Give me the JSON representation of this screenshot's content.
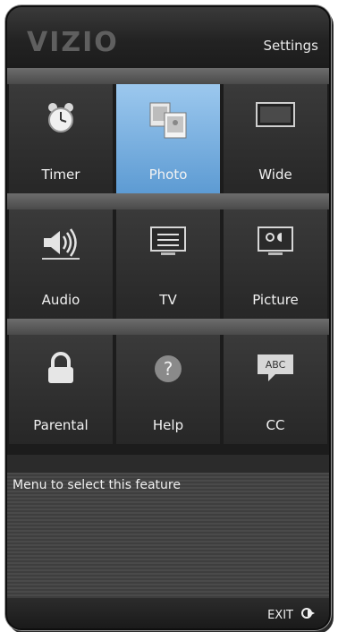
{
  "header": {
    "brand": "VIZIO",
    "title": "Settings"
  },
  "tiles": [
    {
      "label": "Timer",
      "icon": "alarm-clock-icon",
      "selected": false
    },
    {
      "label": "Photo",
      "icon": "photo-icon",
      "selected": true
    },
    {
      "label": "Wide",
      "icon": "widescreen-icon",
      "selected": false
    },
    {
      "label": "Audio",
      "icon": "speaker-icon",
      "selected": false
    },
    {
      "label": "TV",
      "icon": "tv-settings-icon",
      "selected": false
    },
    {
      "label": "Picture",
      "icon": "picture-settings-icon",
      "selected": false
    },
    {
      "label": "Parental",
      "icon": "lock-icon",
      "selected": false
    },
    {
      "label": "Help",
      "icon": "help-icon",
      "selected": false
    },
    {
      "label": "CC",
      "icon": "closed-caption-icon",
      "selected": false
    }
  ],
  "info": {
    "text": "Menu to select this feature"
  },
  "footer": {
    "exit_label": "EXIT"
  },
  "colors": {
    "selected": "#7fb4e3",
    "background": "#1c1c1c"
  }
}
